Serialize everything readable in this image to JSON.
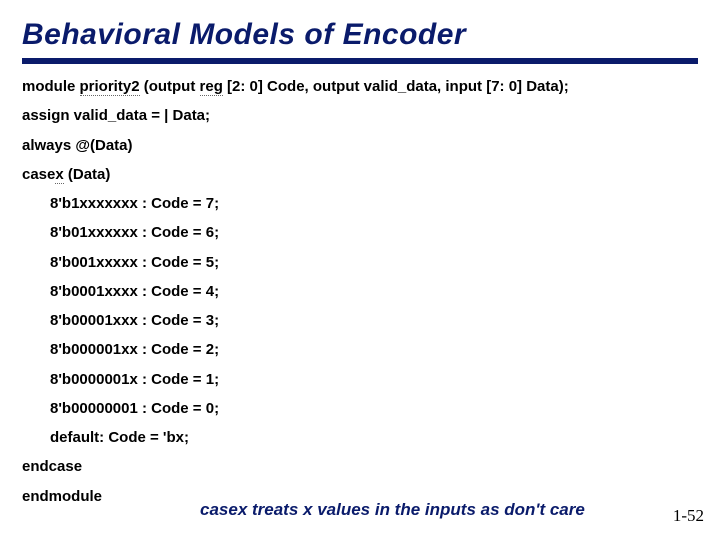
{
  "title": "Behavioral Models of Encoder",
  "module_decl": {
    "prefix": "module ",
    "name": "priority2",
    "mid1": " (output ",
    "reg": "reg",
    "suffix": " [2: 0] Code, output valid_data, input [7: 0] Data);"
  },
  "lines": {
    "assign": "assign valid_data = | Data;",
    "always": "always @(Data)",
    "casex_head_pre": "case",
    "casex_head_x": "x",
    "casex_head_post": " (Data)",
    "c7": "8'b1xxxxxxx : Code = 7;",
    "c6": "8'b01xxxxxx : Code = 6;",
    "c5": "8'b001xxxxx : Code = 5;",
    "c4": "8'b0001xxxx : Code = 4;",
    "c3": "8'b00001xxx : Code = 3;",
    "c2": "8'b000001xx : Code = 2;",
    "c1": "8'b0000001x : Code = 1;",
    "c0": "8'b00000001 : Code = 0;",
    "default": "default: Code = 'bx;",
    "endcase": "endcase",
    "endmodule": "endmodule"
  },
  "footnote": "casex treats x values in the inputs as don't care",
  "page": "1-52"
}
